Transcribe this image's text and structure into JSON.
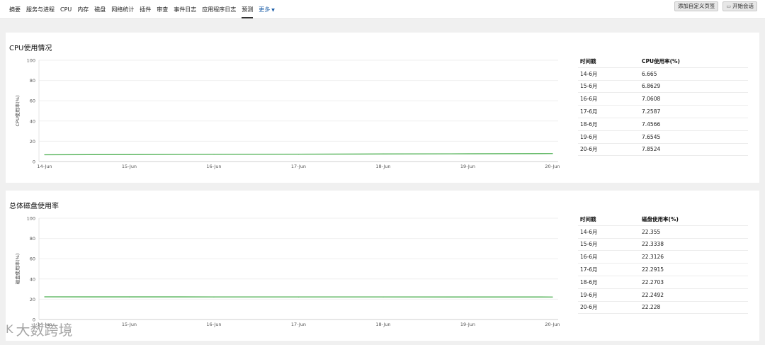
{
  "nav": {
    "tabs": [
      "摘要",
      "服务与进程",
      "CPU",
      "内存",
      "磁盘",
      "网络统计",
      "插件",
      "审查",
      "事件日志",
      "应用程序日志",
      "预测"
    ],
    "active_tab": "预测",
    "more_label": "更多",
    "add_custom_label": "添加自定义页签",
    "start_session_label": "开始会话"
  },
  "panels": [
    {
      "title": "CPU使用情况",
      "table": {
        "col1": "时间戳",
        "col2": "CPU使用率(%)",
        "rows": [
          [
            "14-6月",
            "6.665"
          ],
          [
            "15-6月",
            "6.8629"
          ],
          [
            "16-6月",
            "7.0608"
          ],
          [
            "17-6月",
            "7.2587"
          ],
          [
            "18-6月",
            "7.4566"
          ],
          [
            "19-6月",
            "7.6545"
          ],
          [
            "20-6月",
            "7.8524"
          ]
        ]
      }
    },
    {
      "title": "总体磁盘使用率",
      "table": {
        "col1": "时间戳",
        "col2": "磁盘使用率(%)",
        "rows": [
          [
            "14-6月",
            "22.355"
          ],
          [
            "15-6月",
            "22.3338"
          ],
          [
            "16-6月",
            "22.3126"
          ],
          [
            "17-6月",
            "22.2915"
          ],
          [
            "18-6月",
            "22.2703"
          ],
          [
            "19-6月",
            "22.2492"
          ],
          [
            "20-6月",
            "22.228"
          ]
        ]
      }
    }
  ],
  "chart_data": [
    {
      "type": "line",
      "x": [
        "14-Jun",
        "15-Jun",
        "16-Jun",
        "17-Jun",
        "18-Jun",
        "19-Jun",
        "20-Jun"
      ],
      "series": [
        {
          "name": "CPU使用情况",
          "values": [
            6.665,
            6.8629,
            7.0608,
            7.2587,
            7.4566,
            7.6545,
            7.8524
          ]
        }
      ],
      "yticks": [
        "0",
        "20",
        "40",
        "60",
        "80",
        "100"
      ],
      "ylim": [
        0,
        100
      ],
      "ylabel": "CPU使用率(%)",
      "color": "#4caf50",
      "legend": "bottom-left"
    },
    {
      "type": "line",
      "x": [
        "14-Jun",
        "15-Jun",
        "16-Jun",
        "17-Jun",
        "18-Jun",
        "19-Jun",
        "20-Jun"
      ],
      "series": [
        {
          "name": "总体磁盘使用率",
          "values": [
            22.355,
            22.3338,
            22.3126,
            22.2915,
            22.2703,
            22.2492,
            22.228
          ]
        }
      ],
      "yticks": [
        "0",
        "20",
        "40",
        "60",
        "80",
        "100"
      ],
      "ylim": [
        0,
        100
      ],
      "ylabel": "磁盘使用率(%)",
      "color": "#4caf50",
      "legend": "bottom-left"
    }
  ],
  "watermark": {
    "mark": "K",
    "text": "大数跨境"
  }
}
